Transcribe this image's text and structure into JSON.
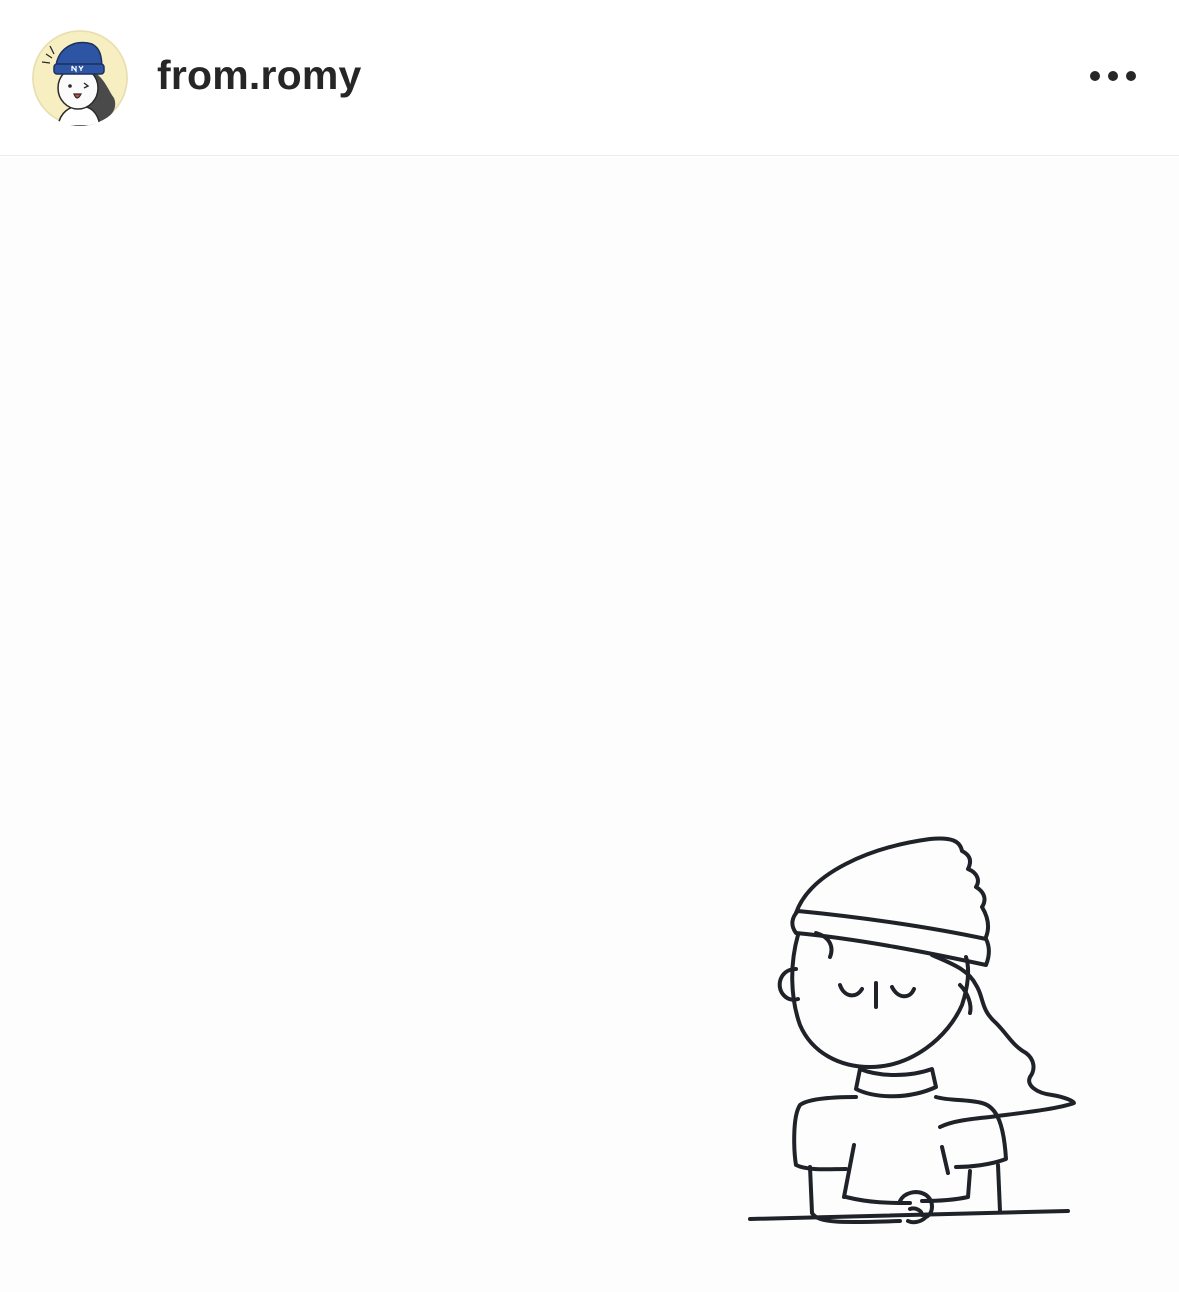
{
  "post": {
    "author": {
      "username": "from.romy",
      "avatar_icon": "illustrated-avatar-girl-blue-beanie"
    },
    "header": {
      "more_icon": "more-options-icon"
    },
    "media": {
      "illustration_icon": "line-drawing-girl-beanie-at-table"
    }
  },
  "colors": {
    "avatar_background": "#f7efc2",
    "beanie_blue": "#2e55a3",
    "line_ink": "#1f2228",
    "text_primary": "#262626",
    "divider": "#ececec"
  }
}
